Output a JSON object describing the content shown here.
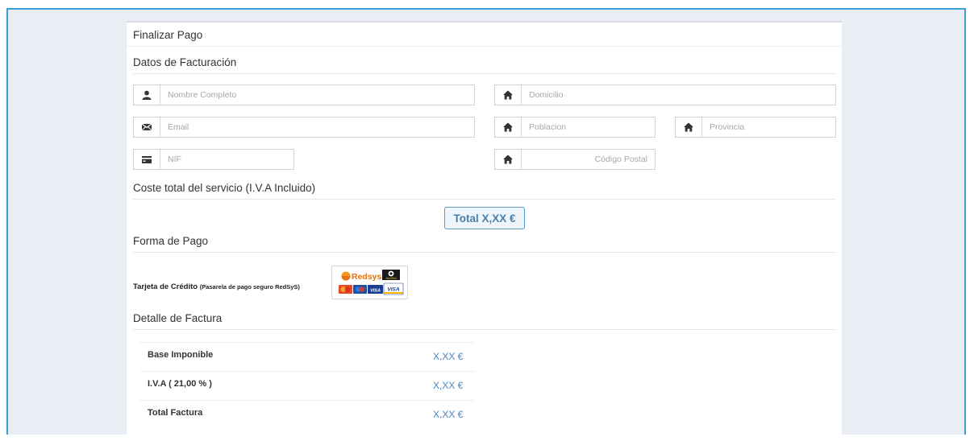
{
  "page_title": "Finalizar Pago",
  "billing": {
    "title": "Datos de Facturación",
    "full_name_placeholder": "Nombre Completo",
    "address_placeholder": "Domicilio",
    "email_placeholder": "Email",
    "city_placeholder": "Poblacion",
    "province_placeholder": "Provincia",
    "nif_placeholder": "NIF",
    "postal_code_placeholder": "Código Postal"
  },
  "cost": {
    "title": "Coste total del servicio (I.V.A Incluido)",
    "total_label": "Total X,XX €"
  },
  "payment": {
    "title": "Forma de Pago",
    "method_label": "Tarjeta de Crédito",
    "method_note": "(Pasarela de pago seguro RedSyS)",
    "logo_text": "Redsys",
    "logo_badge": "ServiRed",
    "card_visa": "VISA"
  },
  "invoice": {
    "title": "Detalle de Factura",
    "rows": [
      {
        "label": "Base Imponible",
        "value": "X,XX €"
      },
      {
        "label": "I.V.A ( 21,00 % )",
        "value": "X,XX €"
      },
      {
        "label": "Total Factura",
        "value": "X,XX €"
      }
    ]
  },
  "icons": {
    "user": "user-icon",
    "home": "home-icon",
    "envelope": "envelope-icon",
    "card": "credit-card-icon"
  },
  "colors": {
    "frame_border": "#3a9fd8",
    "accent_blue": "#4a87bf",
    "background": "#e9eef4"
  }
}
